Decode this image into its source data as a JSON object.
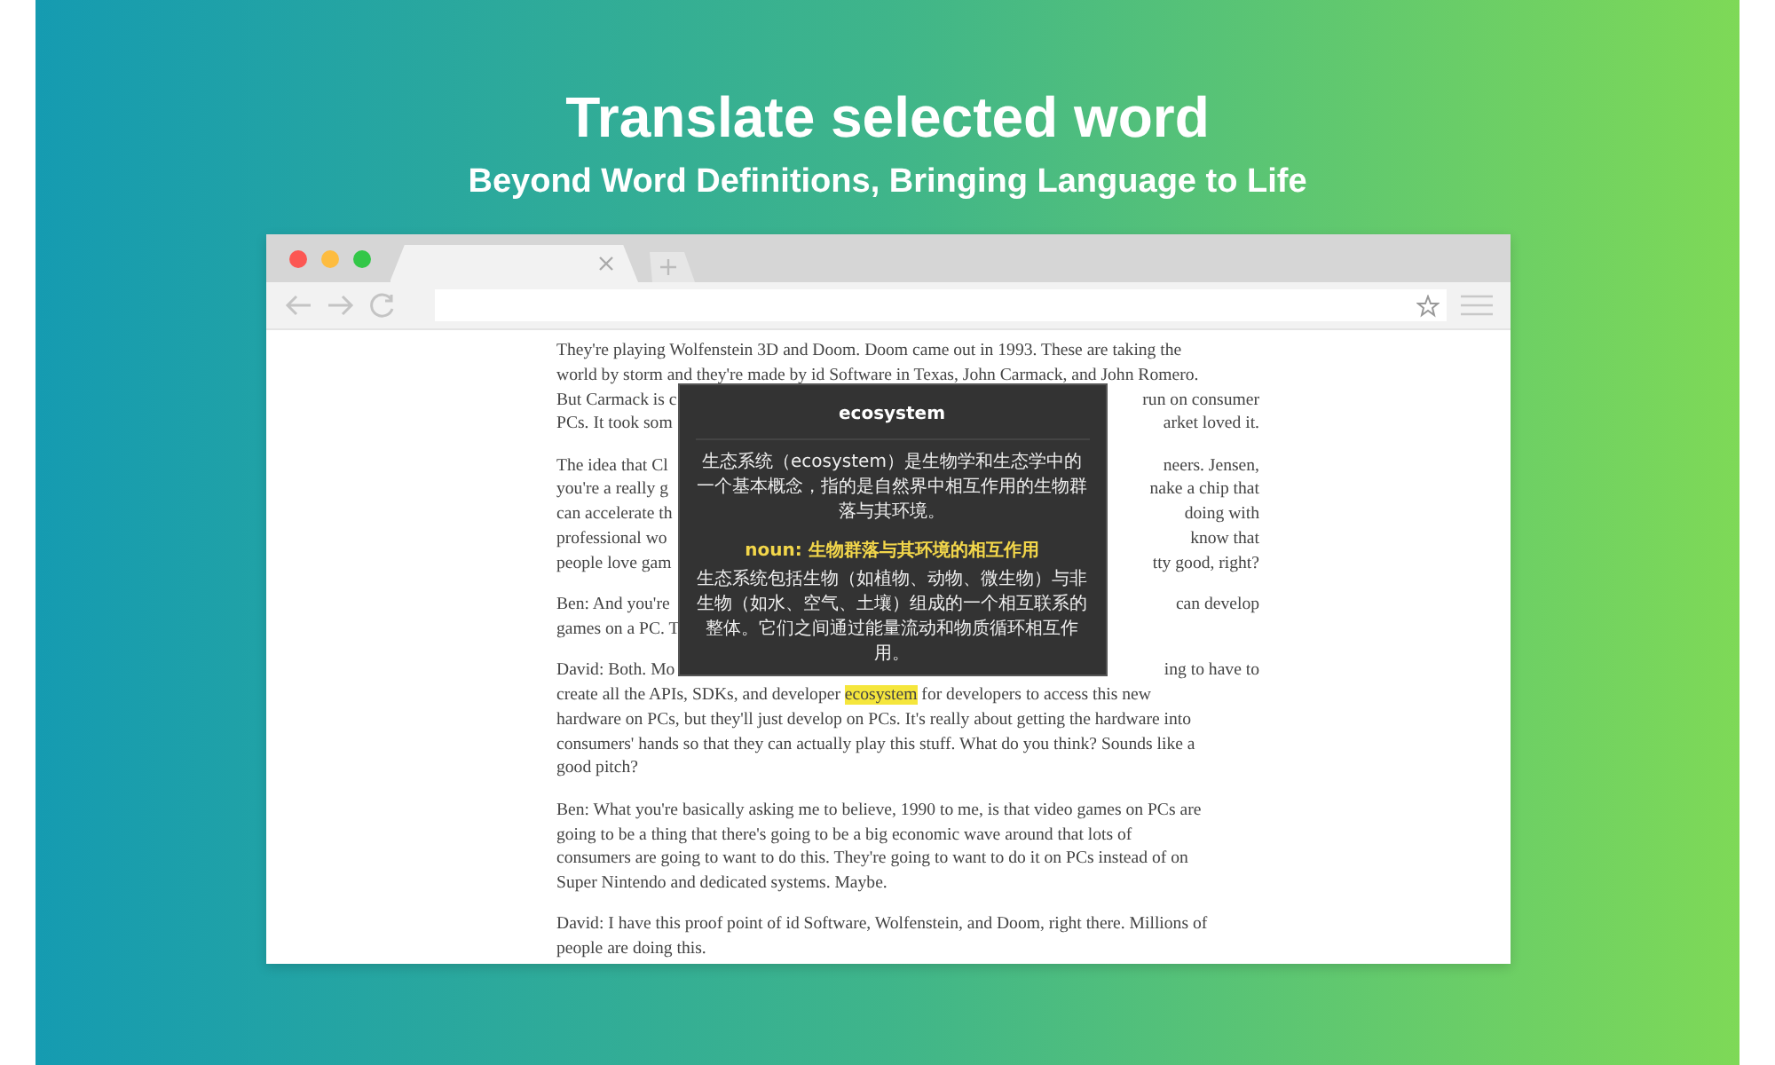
{
  "banner": {
    "title": "Translate selected word",
    "subtitle": "Beyond Word Definitions, Bringing Language to Life"
  },
  "article": {
    "paragraphs": [
      {
        "lines": [
          {
            "kind": "full",
            "text": "They're playing Wolfenstein 3D and Doom. Doom came out in 1993. These are taking the"
          },
          {
            "kind": "full",
            "text": "world by storm and they're made by id Software in Texas, John Carmack, and John Romero."
          },
          {
            "kind": "split",
            "left": "But Carmack is c",
            "right": "run on consumer"
          },
          {
            "kind": "split",
            "left": "PCs. It took som",
            "right": "arket loved it."
          }
        ]
      },
      {
        "lines": [
          {
            "kind": "split",
            "left": "The idea that Cl",
            "right": "neers. Jensen,"
          },
          {
            "kind": "split",
            "left": "you're a really g",
            "right": "nake a chip that"
          },
          {
            "kind": "split",
            "left": "can accelerate th",
            "right": "doing with"
          },
          {
            "kind": "split",
            "left": "professional wo",
            "right": "know that"
          },
          {
            "kind": "split",
            "left": "people love gam",
            "right": "tty good, right?"
          }
        ]
      },
      {
        "lines": [
          {
            "kind": "split",
            "left": "Ben: And you're",
            "right": "can develop"
          },
          {
            "kind": "full",
            "text": "games on a PC. T"
          }
        ]
      },
      {
        "lines": [
          {
            "kind": "split",
            "left": "David: Both. Mo",
            "right": "ing to have to"
          },
          {
            "kind": "highlight",
            "before": "create all the APIs, SDKs, and developer ",
            "highlight": "ecosystem",
            "after": " for developers to access this new"
          },
          {
            "kind": "full",
            "text": "hardware on PCs, but they'll just develop on PCs. It's really about getting the hardware into"
          },
          {
            "kind": "full",
            "text": "consumers' hands so that they can actually play this stuff. What do you think? Sounds like a"
          },
          {
            "kind": "full",
            "text": "good pitch?"
          }
        ]
      },
      {
        "lines": [
          {
            "kind": "full",
            "text": "Ben: What you're basically asking me to believe, 1990 to me, is that video games on PCs are"
          },
          {
            "kind": "full",
            "text": "going to be a thing that there's going to be a big economic wave around that lots of"
          },
          {
            "kind": "full",
            "text": "consumers are going to want to do this. They're going to want to do it on PCs instead of on"
          },
          {
            "kind": "full",
            "text": "Super Nintendo and dedicated systems. Maybe."
          }
        ]
      },
      {
        "lines": [
          {
            "kind": "full",
            "text": "David: I have this proof point of id Software, Wolfenstein, and Doom, right there. Millions of"
          },
          {
            "kind": "full",
            "text": "people are doing this."
          }
        ]
      }
    ]
  },
  "popup": {
    "word": "ecosystem",
    "definition": "生态系统（ecosystem）是生物学和生态学中的一个基本概念，指的是自然界中相互作用的生物群落与其环境。",
    "sense_label": "noun: 生物群落与其环境的相互作用",
    "sense_text": "生态系统包括生物（如植物、动物、微生物）与非生物（如水、空气、土壤）组成的一个相互联系的整体。它们之间通过能量流动和物质循环相互作用。"
  }
}
